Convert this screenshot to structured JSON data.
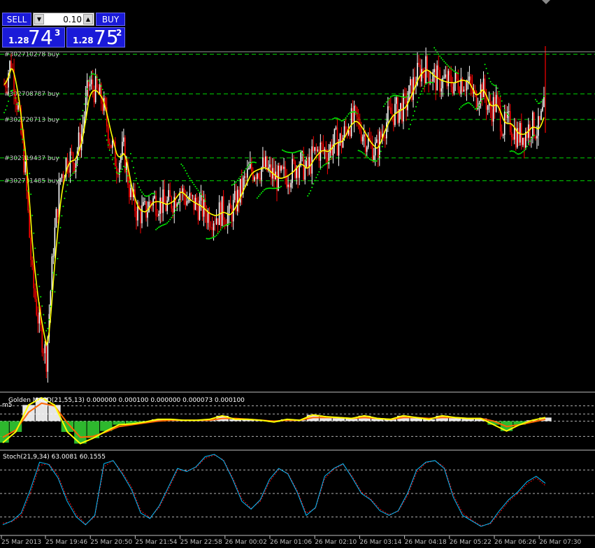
{
  "trade_panel": {
    "sell_label": "SELL",
    "buy_label": "BUY",
    "lot_size": "0.10",
    "sell_prefix": "1.28",
    "sell_big": "74",
    "sell_sup": "3",
    "buy_prefix": "1.28",
    "buy_big": "75",
    "buy_sup": "2",
    "button_color": "#1a1ad8"
  },
  "colors": {
    "background": "#000000",
    "candle_up": "#ffffff",
    "candle_down": "#ff0000",
    "moving_average": "#ffff00",
    "parabolic_sar": "#00ff00",
    "order_line": "#00ff00",
    "macd_main": "#ffff00",
    "macd_signal": "#ff6600",
    "stoch_main": "#00bfff",
    "stoch_signal": "#ff0000",
    "separator": "#c0c0c0"
  },
  "chart_data": [
    {
      "type": "candlestick",
      "title": "",
      "order_lines": [
        {
          "label": "#302710278 buy"
        },
        {
          "label": "#302708787 buy"
        },
        {
          "label": "#302720713 buy"
        },
        {
          "label": "#302719437 buy"
        },
        {
          "label": "#302731485 buy"
        }
      ],
      "x_labels": [
        "25 Mar 2013",
        "25 Mar 19:46",
        "25 Mar 20:50",
        "25 Mar 21:54",
        "25 Mar 22:58",
        "26 Mar 00:02",
        "26 Mar 01:06",
        "26 Mar 02:10",
        "26 Mar 03:14",
        "26 Mar 04:18",
        "26 Mar 05:22",
        "26 Mar 06:26",
        "26 Mar 07:30"
      ],
      "close": [
        1.288,
        1.2893,
        1.2866,
        1.2832,
        1.2774,
        1.2748,
        1.2731,
        1.2792,
        1.2829,
        1.284,
        1.2839,
        1.2853,
        1.288,
        1.2877,
        1.287,
        1.2851,
        1.2837,
        1.2844,
        1.2819,
        1.281,
        1.281,
        1.2817,
        1.2816,
        1.2814,
        1.2817,
        1.2823,
        1.2817,
        1.2815,
        1.2813,
        1.2809,
        1.2808,
        1.2811,
        1.2808,
        1.2816,
        1.2825,
        1.2833,
        1.2834,
        1.2835,
        1.2831,
        1.2828,
        1.283,
        1.2833,
        1.2838,
        1.2833,
        1.2841,
        1.2845,
        1.2843,
        1.2849,
        1.2849,
        1.2859,
        1.2861,
        1.2854,
        1.2847,
        1.2844,
        1.2857,
        1.2864,
        1.2866,
        1.2868,
        1.2878,
        1.2887,
        1.2889,
        1.2884,
        1.2882,
        1.2881,
        1.2881,
        1.2883,
        1.2881,
        1.2872,
        1.2879,
        1.2866,
        1.287,
        1.2857,
        1.2859,
        1.2852,
        1.2853,
        1.2858,
        1.2855,
        1.2869
      ],
      "ma_label": "MA",
      "sar_label": "Parabolic SAR"
    },
    {
      "type": "line",
      "title": "Golden MACD(21,55,13) 0.000000 0.000100 0.000000 0.000073 0.000100",
      "sub_label": "m5",
      "series": [
        {
          "values": [
            -0.0024,
            -0.0012,
            0.0018,
            0.0026,
            0.0018,
            -0.0012,
            -0.0025,
            -0.0019,
            -0.0011,
            -0.0004,
            -0.0003,
            -0.0001,
            0.0002,
            0.0002,
            0.0001,
            0.0001,
            0.0002,
            0.0006,
            0.0002,
            0.0002,
            0.0001,
            -0.0001,
            0.0002,
            0.0001,
            0.0007,
            0.0005,
            0.0004,
            0.0003,
            0.0006,
            0.0003,
            0.0002,
            0.0006,
            0.0004,
            0.0002,
            0.0006,
            0.0004,
            0.0003,
            0.0003,
            -0.0004,
            -0.0011,
            -0.0004,
            0.0001,
            0.0004
          ]
        },
        {
          "values": [
            -0.0018,
            -0.001,
            0.001,
            0.002,
            0.0017,
            -0.0002,
            -0.0018,
            -0.0017,
            -0.0012,
            -0.0006,
            -0.0004,
            -0.0002,
            0.0,
            0.0001,
            0.0001,
            0.0001,
            0.0001,
            0.0003,
            0.0003,
            0.0002,
            0.0001,
            0.0,
            0.0001,
            0.0001,
            0.0004,
            0.0004,
            0.0004,
            0.0003,
            0.0004,
            0.0003,
            0.0002,
            0.0004,
            0.0004,
            0.0003,
            0.0004,
            0.0004,
            0.0003,
            0.0003,
            0.0,
            -0.0006,
            -0.0004,
            -0.0001,
            0.0002
          ]
        }
      ],
      "levels": [
        0.0017,
        0.0008,
        0.0,
        -0.0017
      ]
    },
    {
      "type": "line",
      "title": "Stoch(21,9,34) 63.0081 60.1555",
      "series": [
        {
          "values": [
            10,
            15,
            25,
            55,
            90,
            87,
            70,
            40,
            20,
            10,
            22,
            88,
            92,
            75,
            55,
            25,
            18,
            34,
            58,
            82,
            78,
            84,
            97,
            100,
            92,
            68,
            40,
            30,
            42,
            68,
            82,
            75,
            52,
            22,
            32,
            72,
            82,
            88,
            70,
            50,
            42,
            28,
            22,
            28,
            50,
            80,
            90,
            92,
            82,
            45,
            22,
            15,
            8,
            12,
            28,
            42,
            52,
            65,
            72,
            63
          ]
        },
        {
          "values": [
            12,
            14,
            22,
            50,
            86,
            88,
            73,
            44,
            23,
            11,
            20,
            84,
            92,
            77,
            58,
            28,
            19,
            32,
            55,
            80,
            79,
            83,
            95,
            99,
            93,
            70,
            43,
            31,
            40,
            65,
            81,
            76,
            54,
            25,
            31,
            69,
            81,
            87,
            72,
            52,
            43,
            30,
            23,
            27,
            47,
            77,
            89,
            92,
            84,
            48,
            25,
            16,
            9,
            11,
            25,
            40,
            50,
            62,
            70,
            60
          ]
        }
      ],
      "ylim": [
        0,
        100
      ],
      "levels": [
        80,
        50,
        20
      ]
    }
  ]
}
